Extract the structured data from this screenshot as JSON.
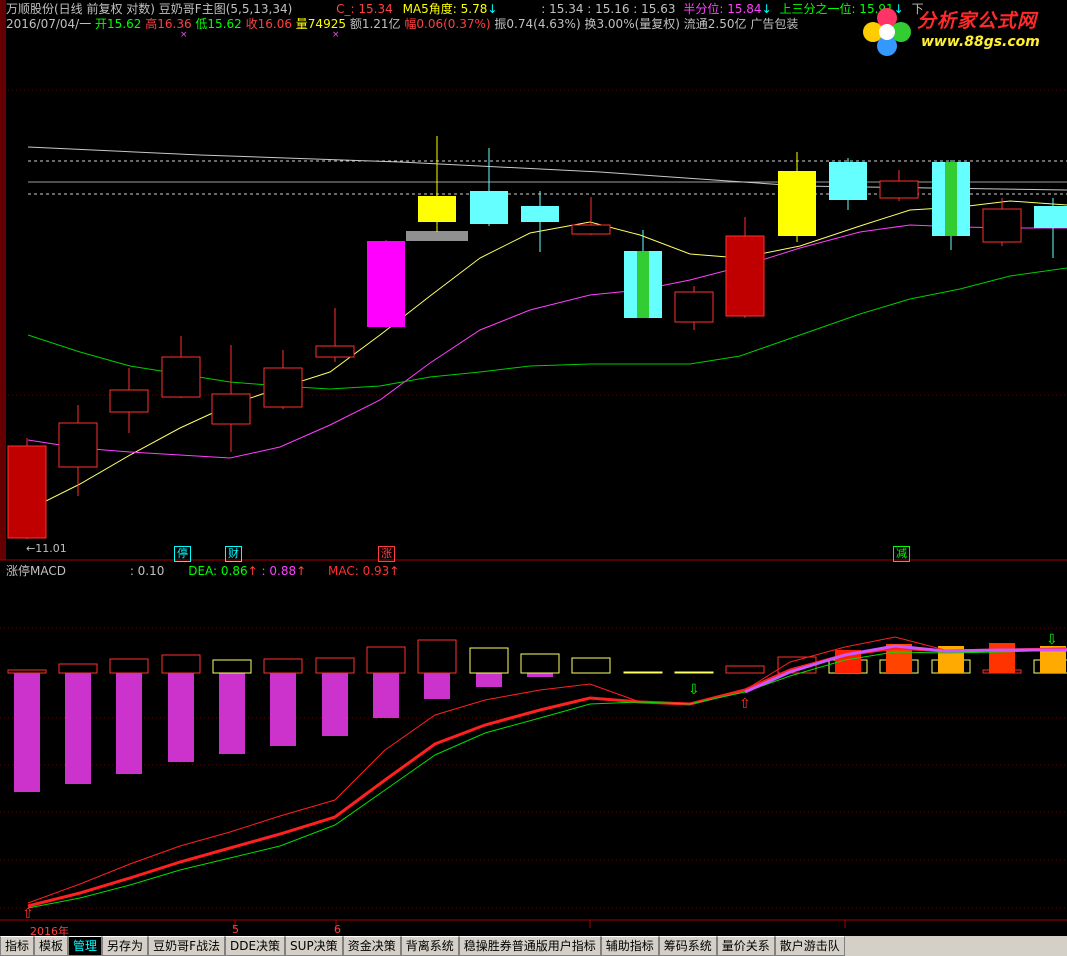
{
  "header": {
    "title": "万顺股份(日线 前复权 对数) 豆奶哥F主图(5,5,13,34)",
    "c_label": "C_: 15.34",
    "ma5_label": "MA5角度: 5.78",
    "vals": ": 15.34 : 15.16 : 15.63",
    "half_label": "半分位: 15.84",
    "third_label": "上三分之一位: 15.91",
    "down_label": "下"
  },
  "quote": {
    "date": "2016/07/04/一",
    "open": "开15.62",
    "high": "高16.36",
    "low": "低15.62",
    "close": "收16.06",
    "volume": "量74925",
    "amount": "额1.21亿",
    "change": "幅0.06(0.37%)",
    "amplitude": "振0.74(4.63%)",
    "turnover": "换3.00%(量复权)",
    "float": "流通2.50亿",
    "sector": "广告包装"
  },
  "logo": {
    "name": "分析家公式网",
    "url": "www.88gs.com"
  },
  "low_mark": "←11.01",
  "tags": [
    {
      "text": "停",
      "color": "#00ffff",
      "pos": 174
    },
    {
      "text": "财",
      "color": "#00ffff",
      "pos": 225
    },
    {
      "text": "涨",
      "color": "#ff4040",
      "pos": 378
    },
    {
      "text": "减",
      "color": "#00ff00",
      "pos": 893
    }
  ],
  "macd": {
    "name": "涨停MACD",
    "v1": ": 0.10",
    "dea": "DEA: 0.86",
    "v2": ": 0.88",
    "mac": "MAC: 0.93"
  },
  "axis": {
    "year": "2016年",
    "m5": "5",
    "m6": "6"
  },
  "tabs": [
    "指标",
    "模板",
    "管理",
    "另存为",
    "豆奶哥F战法",
    "DDE决策",
    "SUP决策",
    "资金决策",
    "背离系统",
    "稳操胜券普通版用户指标",
    "辅助指标",
    "筹码系统",
    "量价关系",
    "散户游击队"
  ],
  "active_tab": "管理",
  "colors": {
    "up": "#ff3030",
    "down": "#00ffff",
    "ma_yellow": "#ffff66",
    "ma_purple": "#ff40ff",
    "ma_green": "#00cc00"
  }
}
